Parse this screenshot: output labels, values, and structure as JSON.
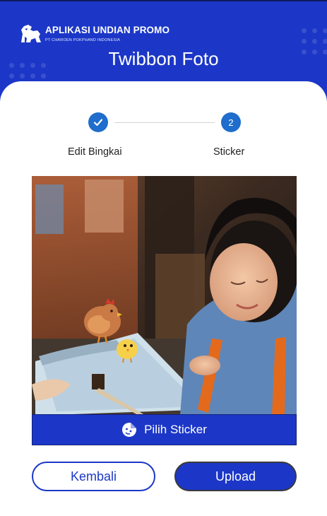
{
  "header": {
    "brand_title": "APLIKASI UNDIAN PROMO",
    "brand_subtitle": "PT CHAROEN POKPHAND INDONESIA",
    "page_title": "Twibbon Foto",
    "logo_icon": "lion-logo-icon",
    "color": "#1c37c7"
  },
  "stepper": {
    "steps": [
      {
        "label": "Edit Bingkai",
        "state": "done",
        "icon": "check-icon"
      },
      {
        "label": "Sticker",
        "state": "active",
        "number": "2"
      }
    ],
    "active_color": "#1f6dcc"
  },
  "photo": {
    "description_icon": "photo-preview",
    "stickers": [
      "chicken-sticker-icon",
      "chick-sticker-icon"
    ]
  },
  "actions": {
    "pick_sticker_label": "Pilih Sticker",
    "pick_sticker_icon": "sticker-smiley-icon",
    "back_label": "Kembali",
    "upload_label": "Upload"
  }
}
